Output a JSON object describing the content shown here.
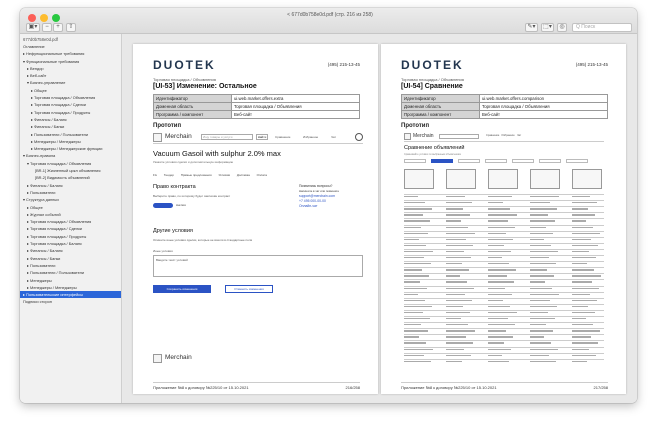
{
  "window": {
    "title": "< 677d0b758e0d.pdf (стр. 216 из 258)",
    "search_placeholder": "Q  Поиск",
    "toolbar_left": [
      "▣▾",
      "−",
      "+",
      "⇧"
    ],
    "toolbar_right": [
      "✎▾",
      "⬚▾",
      "◎"
    ]
  },
  "sidebar": {
    "file": "677d0b758e0d.pdf",
    "items": [
      {
        "label": "Оглавление",
        "indent": 0
      },
      {
        "label": "▸ Нефункциональные требования",
        "indent": 0
      },
      {
        "label": "▾ Функциональные требования",
        "indent": 0
      },
      {
        "label": "▸ Вендор",
        "indent": 1
      },
      {
        "label": "▸ Веб-сайт",
        "indent": 1
      },
      {
        "label": "▾ Бизнес-управление",
        "indent": 1
      },
      {
        "label": "▸ Общее",
        "indent": 2
      },
      {
        "label": "▸ Торговая площадка / Объявления",
        "indent": 2
      },
      {
        "label": "▸ Торговая площадка / Сделки",
        "indent": 2
      },
      {
        "label": "▸ Торговая площадка / Продукты",
        "indent": 2
      },
      {
        "label": "▸ Финансы / Баланс",
        "indent": 2
      },
      {
        "label": "▸ Финансы / Банки",
        "indent": 2
      },
      {
        "label": "▸ Пользователи / Пользователи",
        "indent": 2
      },
      {
        "label": "▸ Менеджеры / Менеджеры",
        "indent": 2
      },
      {
        "label": "▸ Менеджеры / Менеджерские функции",
        "indent": 2
      },
      {
        "label": "▾ Бизнес-правила",
        "indent": 0
      },
      {
        "label": "▾ Торговая площадка / Объявления",
        "indent": 1
      },
      {
        "label": "[BR-1] Жизненный цикл объявления",
        "indent": 3
      },
      {
        "label": "[BR-2] Видимость объявлений",
        "indent": 3
      },
      {
        "label": "▸ Финансы / Баланс",
        "indent": 1
      },
      {
        "label": "▸ Пользователи",
        "indent": 1
      },
      {
        "label": "▾ Структура данных",
        "indent": 0
      },
      {
        "label": "▸ Общее",
        "indent": 1
      },
      {
        "label": "▸ Журнал событий",
        "indent": 1
      },
      {
        "label": "▸ Торговая площадка / Объявления",
        "indent": 1
      },
      {
        "label": "▸ Торговая площадка / Сделки",
        "indent": 1
      },
      {
        "label": "▸ Торговая площадка / Продукты",
        "indent": 1
      },
      {
        "label": "▸ Торговая площадка / Баланс",
        "indent": 1
      },
      {
        "label": "▸ Финансы / Баланс",
        "indent": 1
      },
      {
        "label": "▸ Финансы / Банки",
        "indent": 1
      },
      {
        "label": "▸ Пользователи",
        "indent": 1
      },
      {
        "label": "▸ Пользователи / Пользователи",
        "indent": 1
      },
      {
        "label": "▸ Менеджеры",
        "indent": 1
      },
      {
        "label": "▸ Менеджеры / Менеджеры",
        "indent": 1
      },
      {
        "label": "▸ Пользовательские интерфейсы",
        "indent": 0,
        "selected": true
      },
      {
        "label": "Подписи сторон",
        "indent": 0
      }
    ]
  },
  "pages": [
    {
      "logo": "DUOTEK",
      "phone": "(495) 215-13-45",
      "subtitle": "Торговая площадка / Объявления",
      "title": "[UI-53] Изменение: Остальное",
      "table": [
        {
          "k": "Идентификатор",
          "v": "ui.web.market.offers.extra"
        },
        {
          "k": "Доменная область",
          "v": "Торговая площадка / Объявления"
        },
        {
          "k": "Программа / компонент",
          "v": "Веб-сайт"
        }
      ],
      "prototype_label": "Прототип",
      "footer": "Приложение №8 к договору №225/10 от 15.10.2021",
      "page_num": "216/258"
    },
    {
      "logo": "DUOTEK",
      "phone": "(495) 215-13-45",
      "subtitle": "Торговая площадка / Объявления",
      "title": "[UI-54] Сравнение",
      "table": [
        {
          "k": "Идентификатор",
          "v": "ui.web.market.offers.comparison"
        },
        {
          "k": "Доменная область",
          "v": "Торговая площадка / Объявления"
        },
        {
          "k": "Программа / компонент",
          "v": "Веб-сайт"
        }
      ],
      "prototype_label": "Прототип",
      "footer": "Приложение №8 к договору №225/10 от 15.10.2021",
      "page_num": "217/258"
    }
  ],
  "proto1": {
    "logo": "Merchain",
    "search_placeholder": "Ищу товары и услуги",
    "search_btn": "Найти",
    "nav": [
      "Сравнение",
      "Избранное",
      "Чат"
    ],
    "product_title": "Vacuum Gasoil with sulphur 2.0% max",
    "product_sub": "Укажите условия сделки и дополнительную информацию",
    "filters": [
      "Fix",
      "Тендер",
      "Прямые предложения",
      "Условия",
      "Доставка",
      "Оплата"
    ],
    "section1": "Право контракта",
    "section1_text": "Выберите право, по которому будет заключён контракт",
    "toggle_label": "Англия",
    "side_title": "Появились вопросы?",
    "side_text": "Напишите в чат или позвоните",
    "side_links": [
      "support@merchain.com",
      "+7 495 000-00-00",
      "Онлайн-чат"
    ],
    "section2": "Другие условия",
    "section2_text": "Опишите иные условия сделки, которые не вошли в стандартные поля",
    "input_label": "Иные условия",
    "input_value": "Введите текст условий",
    "btn_save": "Сохранить изменения",
    "btn_cancel": "Отменить изменения",
    "footer_logo": "Merchain"
  },
  "proto2": {
    "logo": "Merchain",
    "nav": [
      "Сравнение",
      "Избранное",
      "Чат"
    ],
    "title": "Сравнение объявлений",
    "sub": "Сравнивайте условия по выбранным объявлениям"
  },
  "colors": {
    "accent": "#2b53c4",
    "selection": "#2b66d9",
    "logo": "#23364f"
  }
}
